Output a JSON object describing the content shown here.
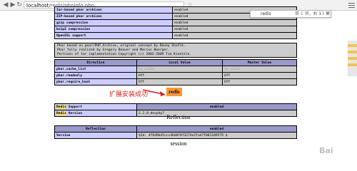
{
  "browser": {
    "url_host": "localhost",
    "url_path": "/redis/phpinfo.php",
    "find_query": "redis",
    "find_count": "第 1 项，共 13 项",
    "prev_label": "‹",
    "next_label": "›",
    "close_label": "×",
    "back_icon": "back-arrow-icon",
    "forward_icon": "forward-arrow-icon",
    "reload_icon": "reload-icon"
  },
  "top_table": [
    {
      "label": "tar-based phar archives",
      "value": "enabled"
    },
    {
      "label": "ZIP-based phar archives",
      "value": "enabled"
    },
    {
      "label": "gzip compression",
      "value": "enabled"
    },
    {
      "label": "bzip2 compression",
      "value": "enabled"
    },
    {
      "label": "OpenSSL support",
      "value": "enabled"
    }
  ],
  "phar_info": {
    "line1": "Phar based on pear/PHP_Archive, original concept by Davey Shafik.",
    "line2": "Phar fully realized by Gregory Beaver and Marcus Boerger.",
    "line3": "Portions of tar implementation Copyright (c) 2003-2009 Tim Kientzle."
  },
  "directive_table": {
    "headers": [
      "Directive",
      "Local Value",
      "Master Value"
    ],
    "rows": [
      {
        "name": "phar.cache_list",
        "local": "no value",
        "master": "no value"
      },
      {
        "name": "phar.readonly",
        "local": "Off",
        "master": "Off"
      },
      {
        "name": "phar.require_hash",
        "local": "Off",
        "master": "Off"
      }
    ]
  },
  "annotation": "扩展安装成功",
  "redis_section": {
    "title": "redis",
    "support_label": "Redis Support",
    "support_highlight": "Redis",
    "support_value": "enabled",
    "version_label": "Redis Version",
    "version_highlight": "Redis",
    "version_value": "2.2.8-devphp7"
  },
  "reflection_section": {
    "title": "Reflection",
    "header_left": "Reflection",
    "header_right": "enabled",
    "version_label": "Version",
    "version_value": "$Id: 4f6d9bd5cccd6d0f8f3274e2fa47f081189579 $"
  },
  "session_section": {
    "title": "session"
  },
  "watermark": "Bai"
}
